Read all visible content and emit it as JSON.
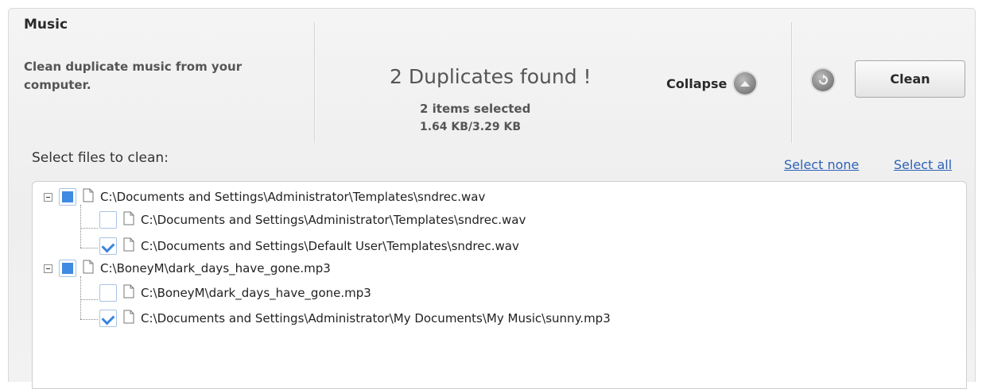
{
  "module": {
    "title": "Music",
    "description": "Clean duplicate music from your computer."
  },
  "summary": {
    "duplicates_text": "2  Duplicates found !",
    "selected_text": "2 items selected",
    "size_text": "1.64 KB/3.29 KB"
  },
  "toolbar": {
    "collapse_label": "Collapse",
    "clean_label": "Clean",
    "collapse_icon": "chevron-up-icon",
    "undo_icon": "undo-icon"
  },
  "selection": {
    "label": "Select files to clean:",
    "select_none": "Select none",
    "select_all": "Select all"
  },
  "groups": [
    {
      "path": "C:\\Documents and Settings\\Administrator\\Templates\\sndrec.wav",
      "state": "partial",
      "items": [
        {
          "path": "C:\\Documents and Settings\\Administrator\\Templates\\sndrec.wav",
          "checked": false
        },
        {
          "path": "C:\\Documents and Settings\\Default User\\Templates\\sndrec.wav",
          "checked": true
        }
      ]
    },
    {
      "path": "C:\\BoneyM\\dark_days_have_gone.mp3",
      "state": "partial",
      "items": [
        {
          "path": "C:\\BoneyM\\dark_days_have_gone.mp3",
          "checked": false
        },
        {
          "path": "C:\\Documents and Settings\\Administrator\\My Documents\\My Music\\sunny.mp3",
          "checked": true
        }
      ]
    }
  ],
  "colors": {
    "accent": "#3f8ae3",
    "link": "#2f62b8"
  }
}
